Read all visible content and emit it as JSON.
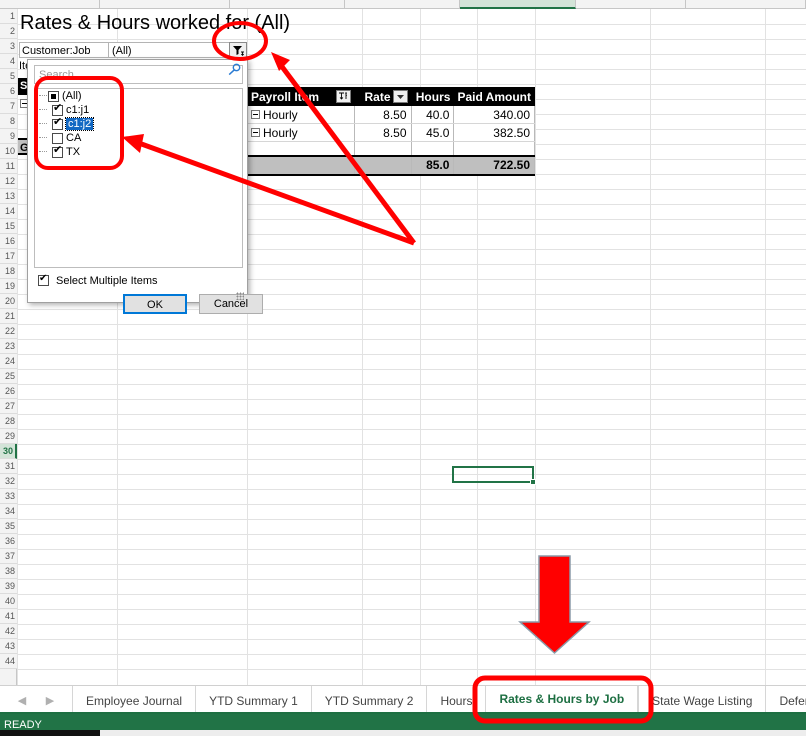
{
  "app": {
    "status_text": "READY"
  },
  "sheet": {
    "title": "Rates & Hours worked for  (All)",
    "page_filter": {
      "label": "Customer:Job",
      "value": "(All)",
      "button_icon": "filter-applied-icon"
    },
    "items_label": "Ite",
    "row_headers": [
      1,
      2,
      3,
      4,
      5,
      6,
      7,
      8,
      9,
      10,
      11,
      12,
      13,
      14,
      15,
      16,
      17,
      18,
      19,
      20,
      21,
      22,
      23,
      24,
      25,
      26,
      27,
      28,
      29,
      30,
      31,
      32,
      33,
      34,
      35,
      36,
      37,
      38,
      39,
      40,
      41,
      42,
      43,
      44
    ],
    "active_row": 30,
    "left_header_cells": {
      "row5": "S",
      "row9": "G"
    }
  },
  "pivot": {
    "columns": [
      {
        "label": "Payroll Item",
        "align": "left",
        "has_sort_filter": true
      },
      {
        "label": "Rate",
        "align": "right",
        "has_filter": true
      },
      {
        "label": "Hours",
        "align": "right",
        "has_filter": false
      },
      {
        "label": "Paid Amount",
        "align": "right",
        "has_filter": false
      }
    ],
    "rows": [
      {
        "item": "Hourly",
        "rate": "8.50",
        "hours": "40.0",
        "paid": "340.00"
      },
      {
        "item": "Hourly",
        "rate": "8.50",
        "hours": "45.0",
        "paid": "382.50"
      }
    ],
    "grand_total": {
      "item": "",
      "rate": "",
      "hours": "85.0",
      "paid": "722.50"
    }
  },
  "filter_dropdown": {
    "search_placeholder": "Search",
    "search_value": "",
    "search_icon": "magnifier-icon",
    "items": [
      {
        "label": "(All)",
        "state": "partial",
        "indent": 0,
        "selected": false
      },
      {
        "label": "c1:j1",
        "state": "checked",
        "indent": 1,
        "selected": false
      },
      {
        "label": "c1:j2",
        "state": "checked",
        "indent": 1,
        "selected": true
      },
      {
        "label": "CA",
        "state": "unchecked",
        "indent": 1,
        "selected": false
      },
      {
        "label": "TX",
        "state": "checked",
        "indent": 1,
        "selected": false
      }
    ],
    "select_multiple_label": "Select Multiple Items",
    "select_multiple_checked": true,
    "ok_label": "OK",
    "cancel_label": "Cancel"
  },
  "tabs": {
    "prev_icon": "chevron-left-icon",
    "next_icon": "chevron-right-icon",
    "items": [
      {
        "label": "Employee Journal",
        "active": false
      },
      {
        "label": "YTD Summary 1",
        "active": false
      },
      {
        "label": "YTD Summary 2",
        "active": false
      },
      {
        "label": "Hours",
        "active": false
      },
      {
        "label": "Rates & Hours by Job",
        "active": true
      },
      {
        "label": "State Wage Listing",
        "active": false
      },
      {
        "label": "Deferre",
        "active": false
      }
    ]
  },
  "annotations": {
    "color": "#FF0000",
    "shapes": [
      {
        "type": "ellipse",
        "name": "circle-filter-button"
      },
      {
        "type": "rounded-rect",
        "name": "box-checkbox-list"
      },
      {
        "type": "arrow",
        "name": "arrow-to-filter-button"
      },
      {
        "type": "arrow",
        "name": "arrow-to-checkbox-list"
      },
      {
        "type": "block-arrow-down",
        "name": "arrow-down-to-sheet-tab"
      },
      {
        "type": "rounded-rect",
        "name": "box-active-sheet-tab"
      }
    ]
  },
  "colors": {
    "excel_green": "#217346",
    "annotation_red": "#FF0000",
    "header_black": "#000000",
    "grand_total_gray": "#BFBFBF",
    "selection_blue": "#1268C3"
  }
}
